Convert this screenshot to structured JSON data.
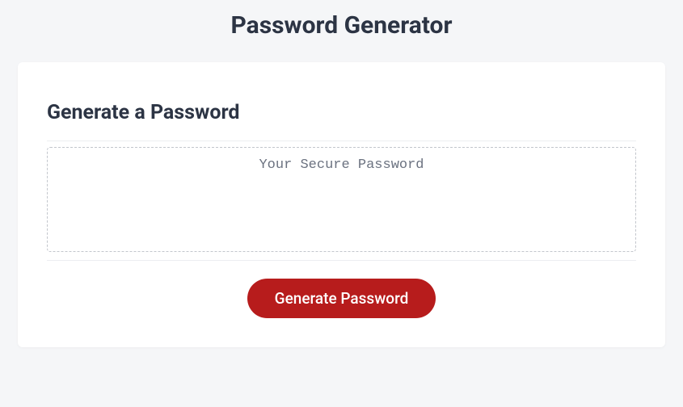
{
  "header": {
    "title": "Password Generator"
  },
  "card": {
    "heading": "Generate a Password",
    "display_placeholder": "Your Secure Password",
    "display_value": "",
    "button_label": "Generate Password"
  }
}
